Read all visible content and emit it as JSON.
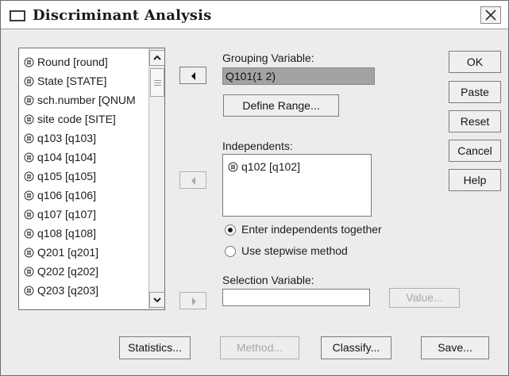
{
  "window": {
    "title": "Discriminant Analysis"
  },
  "variables": {
    "items": [
      "Round [round]",
      "State [STATE]",
      "sch.number [QNUM",
      "site code [SITE]",
      "q103 [q103]",
      "q104 [q104]",
      "q105 [q105]",
      "q106 [q106]",
      "q107 [q107]",
      "q108 [q108]",
      "Q201 [q201]",
      "Q202 [q202]",
      "Q203 [q203]"
    ]
  },
  "grouping": {
    "label": "Grouping Variable:",
    "value": "Q101(1 2)",
    "define_range_label": "Define Range..."
  },
  "independents": {
    "label": "Independents:",
    "items": [
      "q102 [q102]"
    ]
  },
  "method": {
    "option_enter": "Enter independents together",
    "option_stepwise": "Use stepwise method"
  },
  "selection": {
    "label": "Selection Variable:",
    "value": "",
    "value_button": "Value..."
  },
  "side_buttons": {
    "ok": "OK",
    "paste": "Paste",
    "reset": "Reset",
    "cancel": "Cancel",
    "help": "Help"
  },
  "bottom_buttons": {
    "statistics": "Statistics...",
    "method": "Method...",
    "classify": "Classify...",
    "save": "Save..."
  }
}
